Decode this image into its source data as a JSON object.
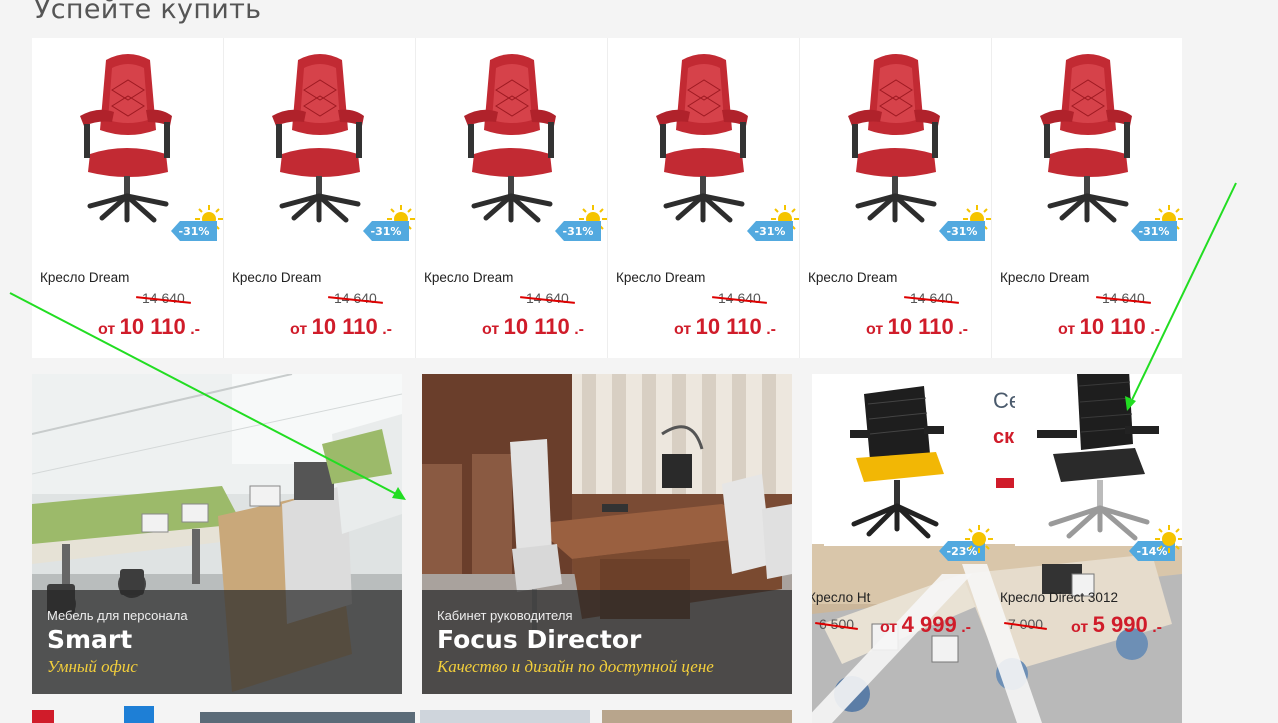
{
  "section": {
    "title": "Успейте купить"
  },
  "products": [
    {
      "name": "Кресло Dream",
      "old_price": "14 640",
      "prefix": "от",
      "price": "10 110",
      "currency": ".-",
      "discount": "-31%"
    },
    {
      "name": "Кресло Dream",
      "old_price": "14 640",
      "prefix": "от",
      "price": "10 110",
      "currency": ".-",
      "discount": "-31%"
    },
    {
      "name": "Кресло Dream",
      "old_price": "14 640",
      "prefix": "от",
      "price": "10 110",
      "currency": ".-",
      "discount": "-31%"
    },
    {
      "name": "Кресло Dream",
      "old_price": "14 640",
      "prefix": "от",
      "price": "10 110",
      "currency": ".-",
      "discount": "-31%"
    },
    {
      "name": "Кресло Dream",
      "old_price": "14 640",
      "prefix": "от",
      "price": "10 110",
      "currency": ".-",
      "discount": "-31%"
    },
    {
      "name": "Кресло Dream",
      "old_price": "14 640",
      "prefix": "от",
      "price": "10 110",
      "currency": ".-",
      "discount": "-31%"
    }
  ],
  "banners": [
    {
      "subtitle": "Мебель для персонала",
      "title": "Smart",
      "tagline": "Умный офис"
    },
    {
      "subtitle": "Кабинет руководителя",
      "title": "Focus Director",
      "tagline": "Качество и дизайн по доступной цене"
    }
  ],
  "right_panel": {
    "partial_heading": "Се",
    "partial_red": "ск",
    "items": [
      {
        "name": "Кресло Ht",
        "old_price": "6 500",
        "prefix": "от",
        "price": "4 999",
        "currency": ".-",
        "discount": "-23%"
      },
      {
        "name": "Кресло Direct 3012",
        "old_price": "7 000",
        "prefix": "от",
        "price": "5 990",
        "currency": ".-",
        "discount": "-14%"
      }
    ]
  },
  "colors": {
    "accent_red": "#d01c2a",
    "badge_blue": "#52a9df",
    "tagline_yellow": "#f3cf3b",
    "annotation_green": "#22dd22"
  }
}
